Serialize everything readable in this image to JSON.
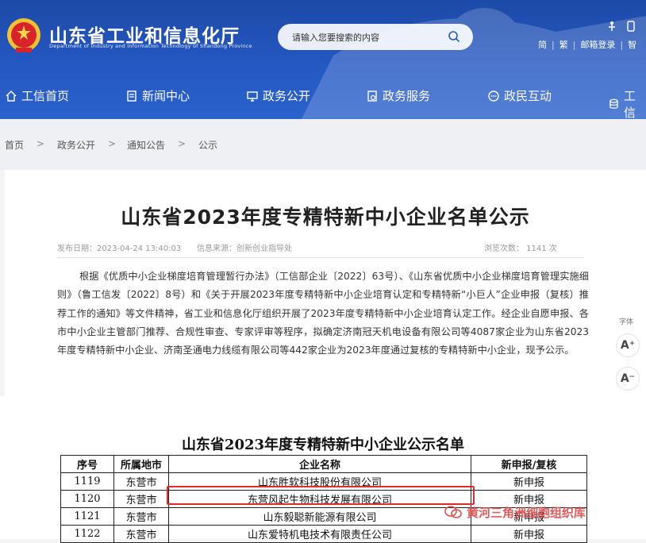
{
  "header": {
    "site_title": "山东省工业和信息化厅",
    "site_subtitle": "Department of Industry and Information Technology of Shandong Province",
    "search_placeholder": "请输入您要搜索的内容",
    "links": [
      "简",
      "繁",
      "邮箱登录",
      "智"
    ]
  },
  "nav": {
    "items": [
      {
        "label": "工信首页",
        "icon": "home-icon"
      },
      {
        "label": "新闻中心",
        "icon": "news-icon"
      },
      {
        "label": "政务公开",
        "icon": "monitor-icon"
      },
      {
        "label": "政务服务",
        "icon": "service-icon"
      },
      {
        "label": "政民互动",
        "icon": "chat-icon"
      },
      {
        "label": "工信",
        "icon": "database-icon"
      }
    ]
  },
  "breadcrumb": [
    "首页",
    "政务公开",
    "通知公告",
    "公示"
  ],
  "article": {
    "title": "山东省2023年度专精特新中小企业名单公示",
    "publish_date": "发布日期：2023-04-24 13:40:03",
    "source": "信息来源：创新创业指导处",
    "views": "浏览次数：  1141   次",
    "body": "根据《优质中小企业梯度培育管理暂行办法》（工信部企业〔2022〕63号）、《山东省优质中小企业梯度培育管理实施细则》（鲁工信发〔2022〕8号）和《关于开展2023年度专精特新中小企业培育认定和专精特新“小巨人”企业申报（复核）推荐工作的通知》等文件精神，省工业和信息化厅组织开展了2023年度专精特新中小企业培育认定工作。经企业自愿申报、各市中小企业主管部门推荐、合规性审查、专家评审等程序，拟确定济南冠天机电设备有限公司等4087家企业为山东省2023年度专精特新中小企业、济南圣通电力线缆有限公司等442家企业为2023年度通过复核的专精特新中小企业，现予公示。"
  },
  "font_tools": {
    "label": "字体",
    "increase": "A⁺",
    "decrease": "A⁻"
  },
  "list": {
    "title": "山东省2023年度专精特新中小企业公示名单",
    "columns": [
      "序号",
      "所属地市",
      "企业名称",
      "新申报/复核"
    ],
    "rows": [
      [
        "1119",
        "东营市",
        "山东胜软科技股份有限公司",
        "新申报"
      ],
      [
        "1120",
        "东营市",
        "东营风起生物科技发展有限公司",
        "新申报"
      ],
      [
        "1121",
        "东营市",
        "山东毅聪新能源有限公司",
        "新申报"
      ],
      [
        "1122",
        "东营市",
        "山东爱特机电技术有限责任公司",
        "新申报"
      ]
    ],
    "highlight_color": "#e22a2a"
  },
  "watermark": {
    "text": "黄河三角洲细胞组织库"
  },
  "colors": {
    "header_blue": "#2659c4",
    "nav_text": "#ffffff"
  }
}
